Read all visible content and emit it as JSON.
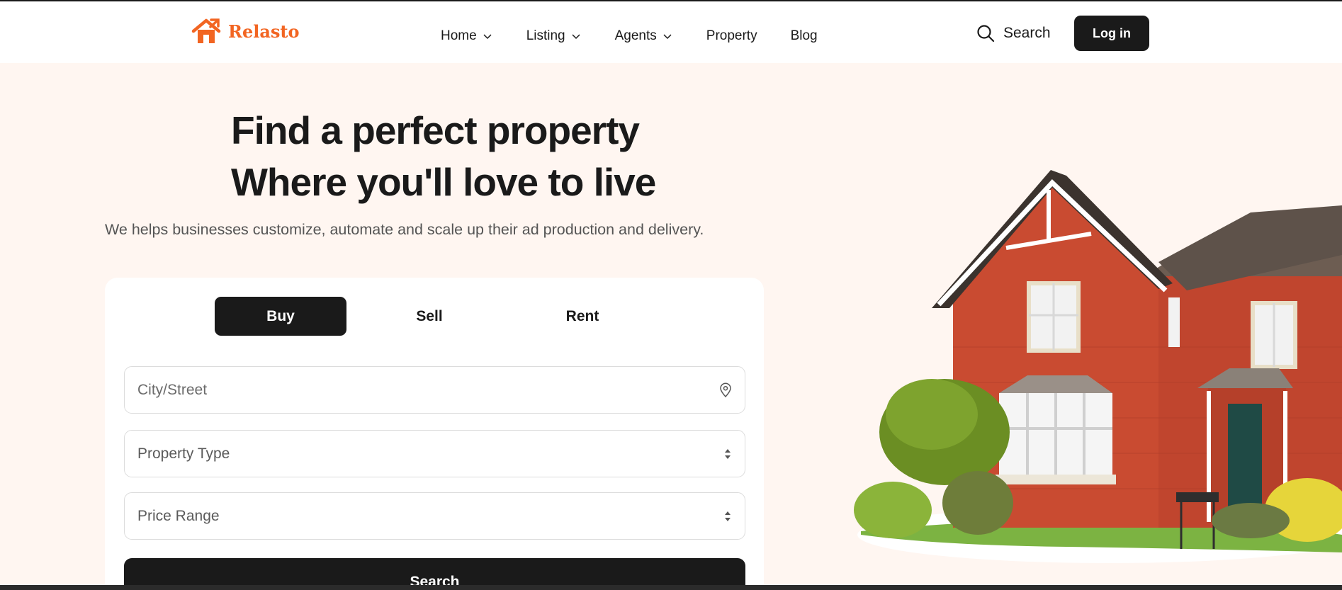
{
  "brand": {
    "name": "Relasto",
    "color": "#f26522",
    "icon": "house-icon"
  },
  "nav": {
    "items": [
      {
        "label": "Home",
        "dropdown": true
      },
      {
        "label": "Listing",
        "dropdown": true
      },
      {
        "label": "Agents",
        "dropdown": true
      },
      {
        "label": "Property",
        "dropdown": false
      },
      {
        "label": "Blog",
        "dropdown": false
      }
    ],
    "search_label": "Search",
    "login_label": "Log in"
  },
  "hero": {
    "title_line1": "Find a perfect property",
    "title_line2": "Where you'll love to live",
    "subtitle": "We helps businesses customize, automate and scale up their ad production and delivery.",
    "image": "brick-house-illustration"
  },
  "search_card": {
    "tabs": [
      {
        "label": "Buy",
        "active": true
      },
      {
        "label": "Sell",
        "active": false
      },
      {
        "label": "Rent",
        "active": false
      }
    ],
    "location_placeholder": "City/Street",
    "location_icon": "map-pin-icon",
    "property_type_label": "Property Type",
    "price_range_label": "Price Range",
    "select_icon": "sort-arrows-icon",
    "submit_label": "Search"
  },
  "colors": {
    "background": "#fff6f1",
    "dark": "#1a1a1a",
    "accent": "#f26522"
  }
}
